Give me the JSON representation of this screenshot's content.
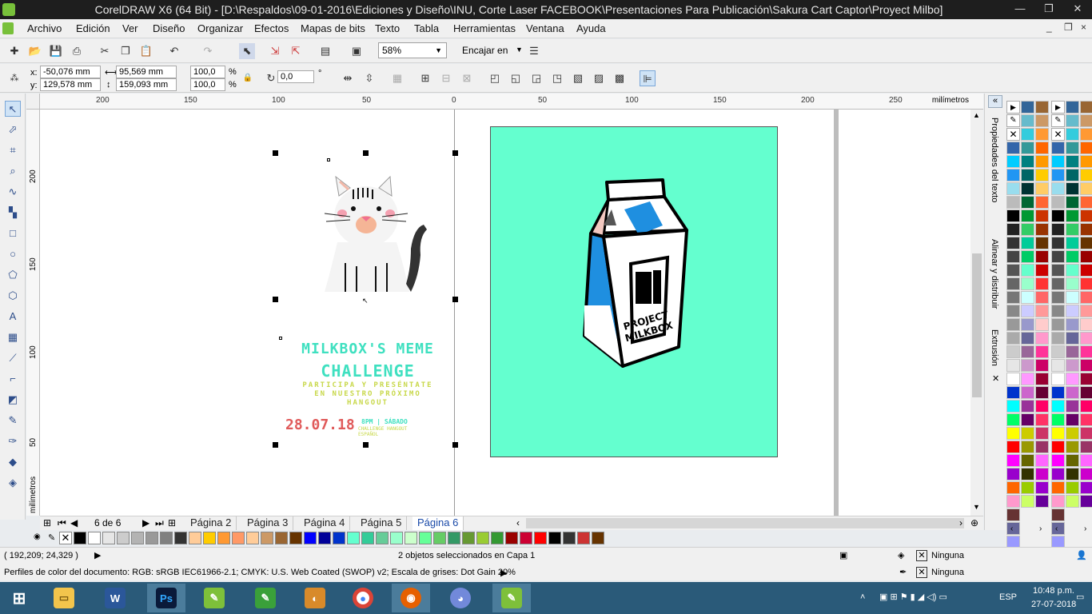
{
  "window": {
    "title": "CorelDRAW X6 (64 Bit) - [D:\\Respaldos\\09-01-2016\\Ediciones y Diseño\\INU, Corte Laser FACEBOOK\\Presentaciones Para Publicación\\Sakura Cart Captor\\Proyect Milbo]",
    "minimize": "—",
    "restore": "❐",
    "close": "✕"
  },
  "menu": {
    "items": [
      "Archivo",
      "Edición",
      "Ver",
      "Diseño",
      "Organizar",
      "Efectos",
      "Mapas de bits",
      "Texto",
      "Tabla",
      "Herramientas",
      "Ventana",
      "Ayuda"
    ],
    "doc_controls": {
      "min": "_",
      "restore": "❐",
      "close": "×"
    }
  },
  "standard_toolbar": {
    "zoom": "58%",
    "snap": "Encajar en"
  },
  "property_bar": {
    "x_label": "x:",
    "y_label": "y:",
    "x": "-50,076 mm",
    "y": "129,578 mm",
    "width": "95,569 mm",
    "height": "159,093 mm",
    "scale_x": "100,0",
    "scale_y": "100,0",
    "pct": "%",
    "rotation": "0,0",
    "deg": "°"
  },
  "ruler": {
    "h_ticks": [
      "200",
      "150",
      "100",
      "50",
      "0",
      "50",
      "100",
      "150",
      "200",
      "250"
    ],
    "unit": "milímetros",
    "v_ticks": [
      "200",
      "150",
      "100",
      "50"
    ],
    "v_unit": "milímetros"
  },
  "artwork": {
    "headline1": "MILKBOX'S MEME",
    "headline2": "CHALLENGE",
    "sub1": "PARTICIPA Y PRESÉNTATE",
    "sub2": "EN NUESTRO PRÓXIMO",
    "sub3": "HANGOUT",
    "date": "28.07.18",
    "time_info": "8PM | SÁBADO",
    "detail1": "CHALLENGE HANGOUT",
    "detail2": "ESPAÑOL",
    "carton_brand1": "PROJECT",
    "carton_brand2": "MILKBOX",
    "colors": {
      "mint": "#64ffcf",
      "title": "#3fe0c0",
      "subtitle": "#c8d84a",
      "date": "#e05a5a",
      "carton_blue": "#1f8fe0"
    }
  },
  "page_nav": {
    "counter": "6 de 6",
    "tabs": [
      "Página 2",
      "Página 3",
      "Página 4",
      "Página 5",
      "Página 6"
    ],
    "active": "Página 6"
  },
  "docker_tabs": [
    "Propiedades del texto",
    "Alinear y distribuir",
    "Extrusión"
  ],
  "status": {
    "coords": "( 192,209; 24,329 )",
    "selection": "2 objetos seleccionados en Capa 1",
    "fill": "Ninguna",
    "outline": "Ninguna",
    "color_profile": "Perfiles de color del documento: RGB: sRGB IEC61966-2.1; CMYK: U.S. Web Coated (SWOP) v2; Escala de grises: Dot Gain 20%"
  },
  "taskbar": {
    "lang": "ESP",
    "time": "10:48 p.m.",
    "date": "27-07-2018",
    "apps": [
      "start-icon",
      "file-explorer-icon",
      "word-icon",
      "photoshop-icon",
      "coreldraw-icon",
      "coreldraw-icon",
      "corel-photo-icon",
      "chrome-icon",
      "firefox-icon",
      "discord-icon",
      "coreldraw-icon"
    ]
  },
  "swatches": [
    "#000000",
    "#ffffff",
    "#e6e6e6",
    "#cccccc",
    "#b3b3b3",
    "#999999",
    "#808080",
    "#333333",
    "#ffcc99",
    "#ffcc00",
    "#ff9933",
    "#ff9966",
    "#ffcc99",
    "#cc9966",
    "#996633",
    "#663300",
    "#0000ff",
    "#000099",
    "#0033cc",
    "#64ffcf",
    "#33cc99",
    "#66cc99",
    "#99ffcc",
    "#ccffcc",
    "#66ff99",
    "#66cc66",
    "#339966",
    "#669933",
    "#99cc33",
    "#339933",
    "#990000",
    "#cc0033",
    "#ff0000",
    "#000000",
    "#333333",
    "#cc3333",
    "#663300"
  ],
  "palette_col1": [
    "#3366aa",
    "#00ccff",
    "#2196f3",
    "#99ddee",
    "#bbbbbb",
    "#000000",
    "#222222",
    "#333333",
    "#444444",
    "#555555",
    "#666666",
    "#777777",
    "#888888",
    "#999999",
    "#aaaaaa",
    "#cccccc",
    "#e6e6e6",
    "#ffffff",
    "#0033cc",
    "#00ffff",
    "#00ff66",
    "#ffff00",
    "#ff0000",
    "#ff00ff",
    "#9900cc",
    "#ff6600",
    "#ff99cc",
    "#663333",
    "#666699",
    "#9999ff",
    "#6666ff",
    "#3333cc",
    "#000066",
    "#0000aa"
  ],
  "palette_col2": [
    "#336699",
    "#66bbcc",
    "#33ccdd",
    "#339999",
    "#008080",
    "#006666",
    "#003333",
    "#006633",
    "#009933",
    "#33cc66",
    "#00cc99",
    "#00cc66",
    "#66ffcc",
    "#99ffcc",
    "#ccffff",
    "#ccccff",
    "#9999cc",
    "#666699",
    "#996699",
    "#cc99cc",
    "#ff99ff",
    "#cc66cc",
    "#993399",
    "#660066",
    "#cccc00",
    "#999900",
    "#666600",
    "#333300",
    "#99cc00",
    "#ccff66",
    "#ffffcc",
    "#ffff99",
    "#ffcc66",
    "#cc9933"
  ],
  "palette_col3": [
    "#996633",
    "#cc9966",
    "#ff9933",
    "#ff6600",
    "#ff9900",
    "#ffcc00",
    "#ffcc66",
    "#ff6633",
    "#cc3300",
    "#993300",
    "#663300",
    "#990000",
    "#cc0000",
    "#ff3333",
    "#ff6666",
    "#ff9999",
    "#ffcccc",
    "#ff99cc",
    "#ff3399",
    "#cc0066",
    "#990033",
    "#660033",
    "#ff0066",
    "#ff3366",
    "#cc3366",
    "#993366",
    "#ff66ff",
    "#cc00cc",
    "#9900cc",
    "#660099",
    "#3300cc",
    "#330099",
    "#6633ff",
    "#9966ff"
  ]
}
